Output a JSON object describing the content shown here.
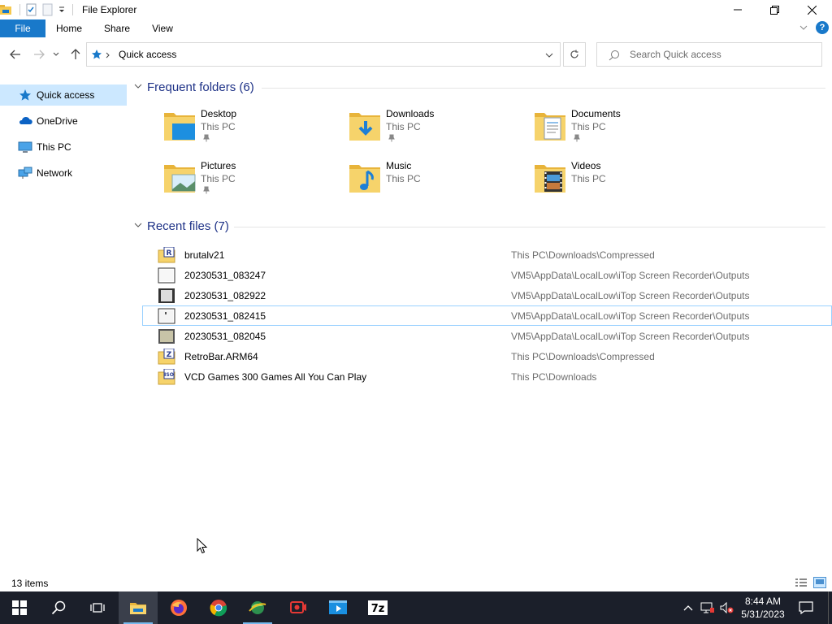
{
  "window": {
    "title": "File Explorer"
  },
  "ribbon": {
    "tabs": [
      "File",
      "Home",
      "Share",
      "View"
    ],
    "help_label": "?"
  },
  "address": {
    "location": "Quick access"
  },
  "search": {
    "placeholder": "Search Quick access"
  },
  "sidebar": {
    "items": [
      {
        "label": "Quick access",
        "icon": "star-icon",
        "selected": true
      },
      {
        "label": "OneDrive",
        "icon": "cloud-icon",
        "selected": false
      },
      {
        "label": "This PC",
        "icon": "computer-icon",
        "selected": false
      },
      {
        "label": "Network",
        "icon": "network-icon",
        "selected": false
      }
    ]
  },
  "frequent": {
    "header": "Frequent folders (6)",
    "folders": [
      {
        "name": "Desktop",
        "location": "This PC",
        "overlay": "desktop"
      },
      {
        "name": "Downloads",
        "location": "This PC",
        "overlay": "download-arrow"
      },
      {
        "name": "Documents",
        "location": "This PC",
        "overlay": "document"
      },
      {
        "name": "Pictures",
        "location": "This PC",
        "overlay": "picture"
      },
      {
        "name": "Music",
        "location": "This PC",
        "overlay": "music-note"
      },
      {
        "name": "Videos",
        "location": "This PC",
        "overlay": "film"
      }
    ]
  },
  "recent": {
    "header": "Recent files (7)",
    "files": [
      {
        "name": "brutalv21",
        "path": "This PC\\Downloads\\Compressed",
        "icon": "rar-archive-icon"
      },
      {
        "name": "20230531_083247",
        "path": "VM5\\AppData\\LocalLow\\iTop Screen Recorder\\Outputs",
        "icon": "video-file-icon"
      },
      {
        "name": "20230531_082922",
        "path": "VM5\\AppData\\LocalLow\\iTop Screen Recorder\\Outputs",
        "icon": "video-file-icon"
      },
      {
        "name": "20230531_082415",
        "path": "VM5\\AppData\\LocalLow\\iTop Screen Recorder\\Outputs",
        "icon": "video-file-icon"
      },
      {
        "name": "20230531_082045",
        "path": "VM5\\AppData\\LocalLow\\iTop Screen Recorder\\Outputs",
        "icon": "video-file-icon"
      },
      {
        "name": "RetroBar.ARM64",
        "path": "This PC\\Downloads\\Compressed",
        "icon": "zip-archive-icon"
      },
      {
        "name": "VCD Games 300 Games All You Can Play",
        "path": "This PC\\Downloads",
        "icon": "iso-file-icon"
      }
    ]
  },
  "status": {
    "item_count": "13 items"
  },
  "taskbar": {
    "time": "8:44 AM",
    "date": "5/31/2023"
  },
  "colors": {
    "accent": "#1979ca",
    "header_text": "#1e3287",
    "selection": "#cce8ff",
    "taskbar": "#1b1f2a",
    "folder_yellow": "#f6d36b"
  }
}
